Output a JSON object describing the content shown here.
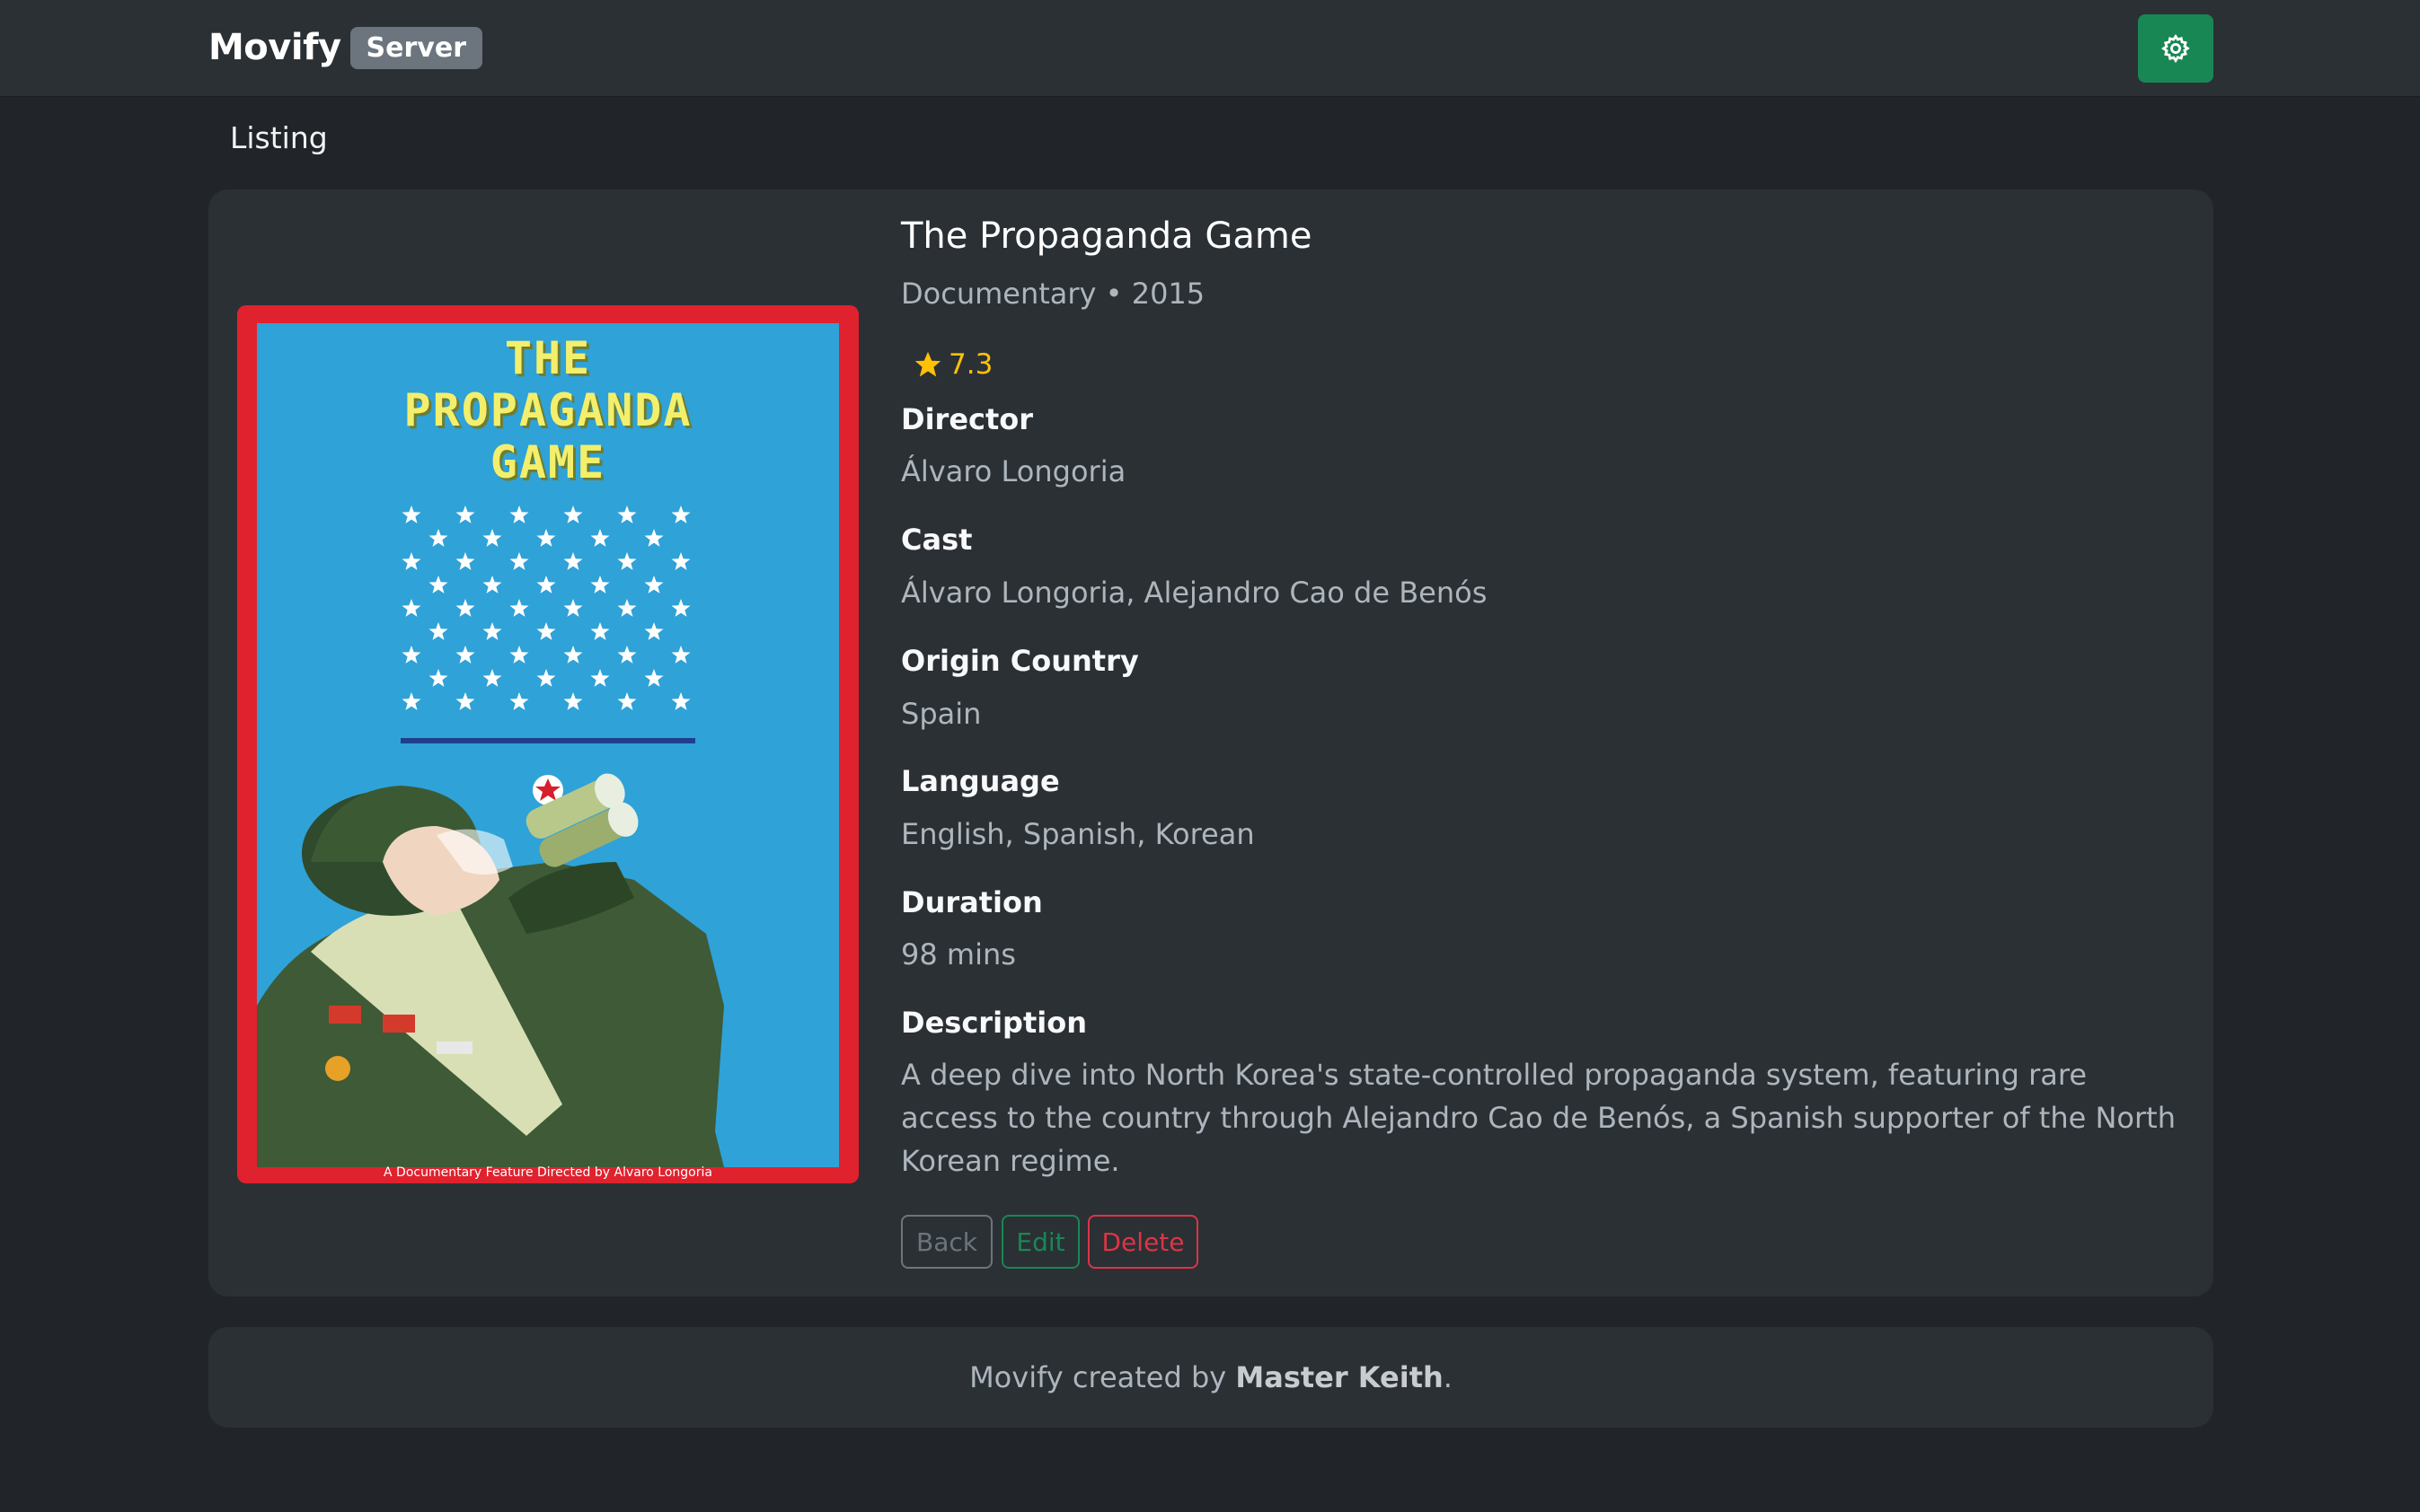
{
  "navbar": {
    "brand": "Movify",
    "badge": "Server",
    "settings_icon": "gear-icon",
    "accent": "#198754"
  },
  "breadcrumb": "Listing",
  "movie": {
    "title": "The Propaganda Game",
    "subtitle": "Documentary • 2015",
    "rating": "7.3",
    "rating_icon": "star-icon",
    "poster": {
      "title_lines": [
        "THE",
        "PROPAGANDA",
        "GAME"
      ],
      "caption": "A Documentary Feature Directed by Alvaro Longoria"
    },
    "director_label": "Director",
    "director": "Álvaro Longoria",
    "cast_label": "Cast",
    "cast": "Álvaro Longoria, Alejandro Cao de Benós",
    "country_label": "Origin Country",
    "country": "Spain",
    "language_label": "Language",
    "language": "English, Spanish, Korean",
    "duration_label": "Duration",
    "duration": "98 mins",
    "description_label": "Description",
    "description_lines": [
      "A deep dive into North Korea's state-controlled propaganda system, featuring rare",
      "access to the country through Alejandro Cao de Benós, a Spanish supporter of the North",
      "Korean regime."
    ]
  },
  "actions": {
    "back": "Back",
    "edit": "Edit",
    "delete": "Delete"
  },
  "footer": {
    "prefix": "Movify created by ",
    "author": "Master Keith",
    "suffix": "."
  }
}
